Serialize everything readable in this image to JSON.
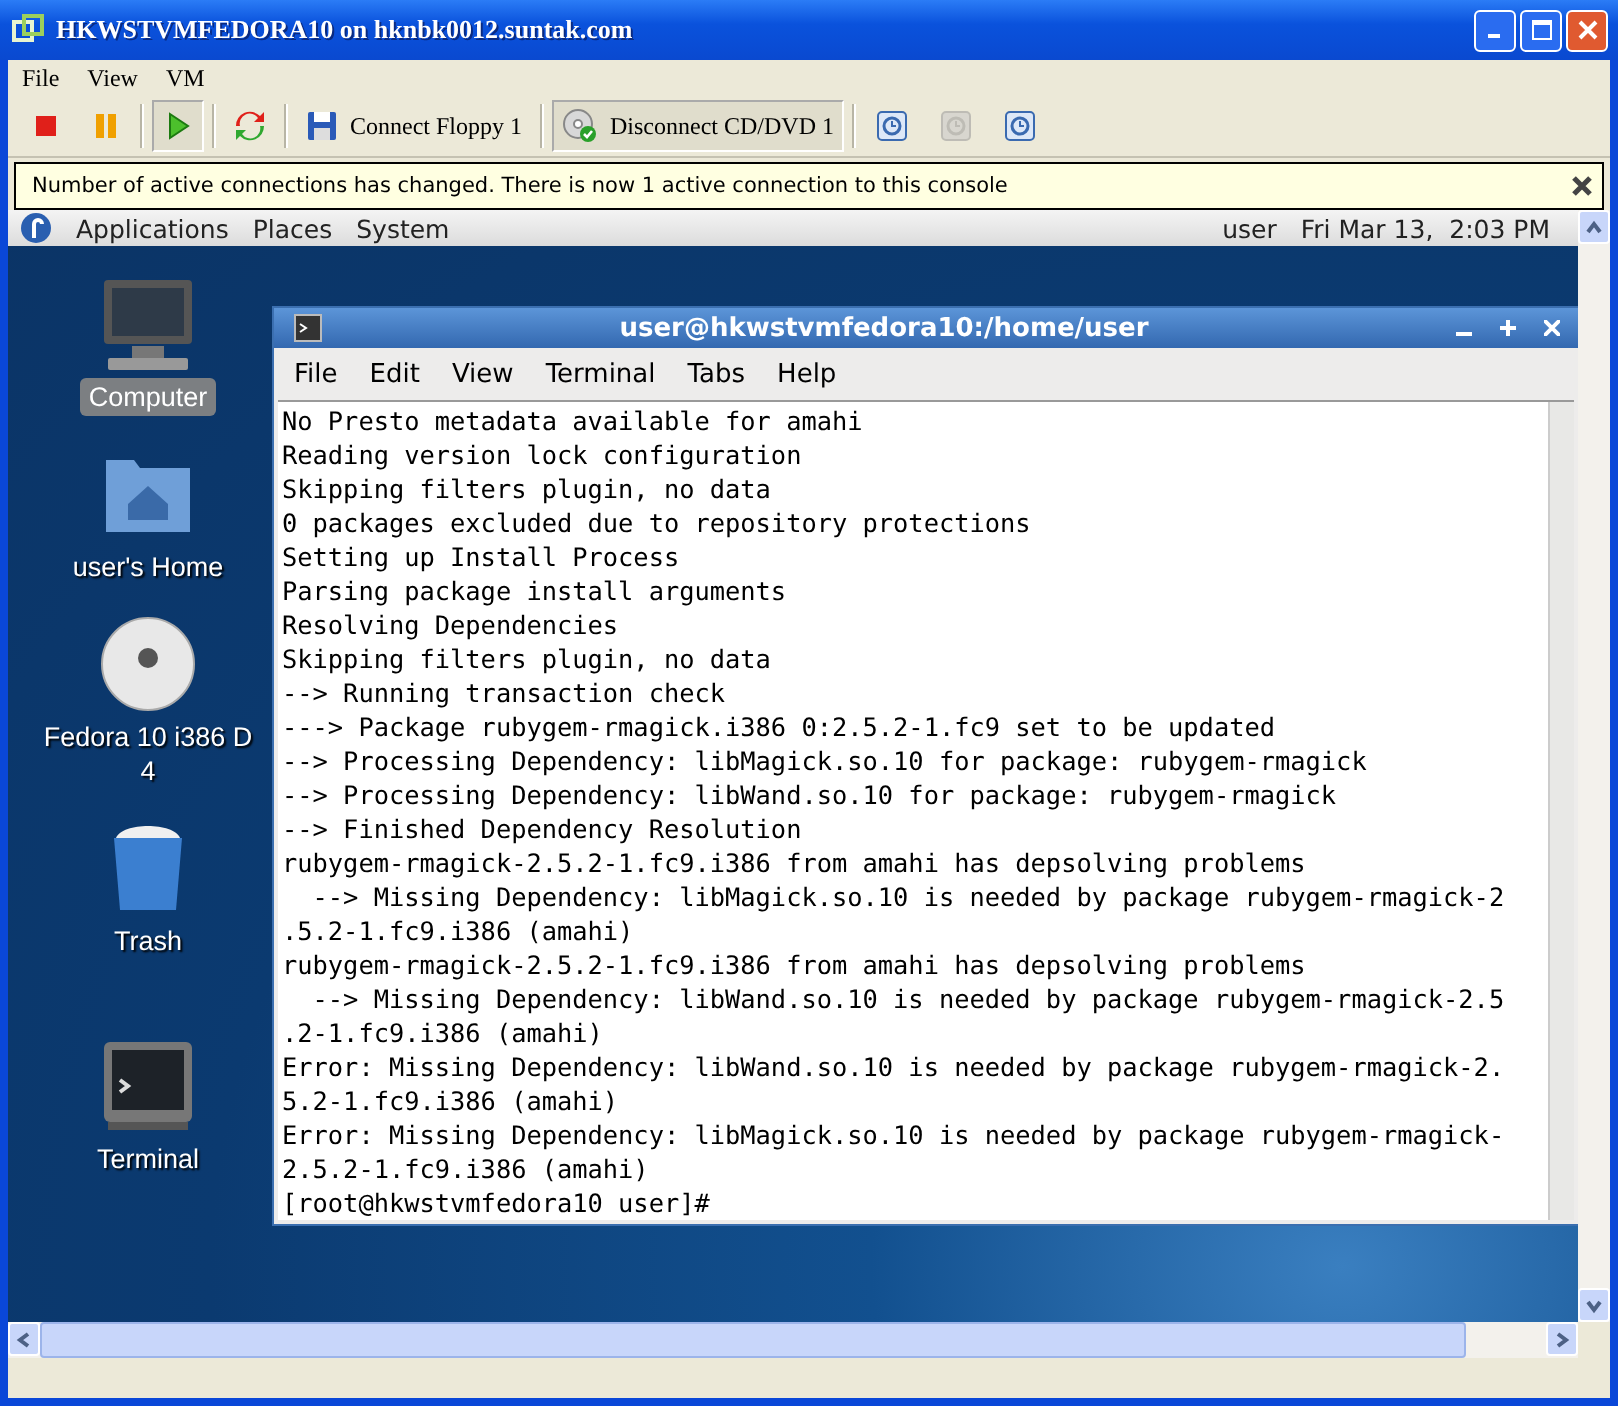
{
  "window": {
    "title": "HKWSTVMFEDORA10 on hknbk0012.suntak.com"
  },
  "menu": [
    "File",
    "View",
    "VM"
  ],
  "toolbar": [
    {
      "kind": "icon",
      "pressed": false,
      "disabled": false
    },
    {
      "kind": "icon",
      "pressed": false,
      "disabled": false
    },
    {
      "kind": "icon",
      "pressed": true,
      "disabled": false
    },
    {
      "kind": "icon",
      "pressed": false,
      "disabled": false
    },
    {
      "kind": "labeled",
      "label": "Connect Floppy 1",
      "pressed": false,
      "disabled": false
    },
    {
      "kind": "labeled",
      "label": "Disconnect CD/DVD 1",
      "pressed": true,
      "disabled": false
    },
    {
      "kind": "icon",
      "pressed": false,
      "disabled": false
    },
    {
      "kind": "icon",
      "pressed": false,
      "disabled": true
    },
    {
      "kind": "icon",
      "pressed": false,
      "disabled": false
    }
  ],
  "notification": {
    "text": "Number of active connections has changed. There is now 1 active connection to this console"
  },
  "guest_panel": {
    "menus": [
      "Applications",
      "Places",
      "System"
    ],
    "user": "user",
    "clock": "Fri Mar 13,  2:03 PM"
  },
  "desktop_icons": [
    {
      "label": "Computer",
      "selected": true
    },
    {
      "label": "user's Home",
      "selected": false
    },
    {
      "label": "Fedora 10 i386 D\n4",
      "selected": false
    },
    {
      "label": "Trash",
      "selected": false
    },
    {
      "label": "Terminal",
      "selected": false
    }
  ],
  "terminal": {
    "title": "user@hkwstvmfedora10:/home/user",
    "menu": [
      "File",
      "Edit",
      "View",
      "Terminal",
      "Tabs",
      "Help"
    ],
    "lines": [
      "No Presto metadata available for amahi",
      "Reading version lock configuration",
      "Skipping filters plugin, no data",
      "0 packages excluded due to repository protections",
      "Setting up Install Process",
      "Parsing package install arguments",
      "Resolving Dependencies",
      "Skipping filters plugin, no data",
      "--> Running transaction check",
      "---> Package rubygem-rmagick.i386 0:2.5.2-1.fc9 set to be updated",
      "--> Processing Dependency: libMagick.so.10 for package: rubygem-rmagick",
      "--> Processing Dependency: libWand.so.10 for package: rubygem-rmagick",
      "--> Finished Dependency Resolution",
      "rubygem-rmagick-2.5.2-1.fc9.i386 from amahi has depsolving problems",
      "  --> Missing Dependency: libMagick.so.10 is needed by package rubygem-rmagick-2",
      ".5.2-1.fc9.i386 (amahi)",
      "rubygem-rmagick-2.5.2-1.fc9.i386 from amahi has depsolving problems",
      "  --> Missing Dependency: libWand.so.10 is needed by package rubygem-rmagick-2.5",
      ".2-1.fc9.i386 (amahi)",
      "Error: Missing Dependency: libWand.so.10 is needed by package rubygem-rmagick-2.",
      "5.2-1.fc9.i386 (amahi)",
      "Error: Missing Dependency: libMagick.so.10 is needed by package rubygem-rmagick-",
      "2.5.2-1.fc9.i386 (amahi)",
      "[root@hkwstvmfedora10 user]#"
    ]
  }
}
